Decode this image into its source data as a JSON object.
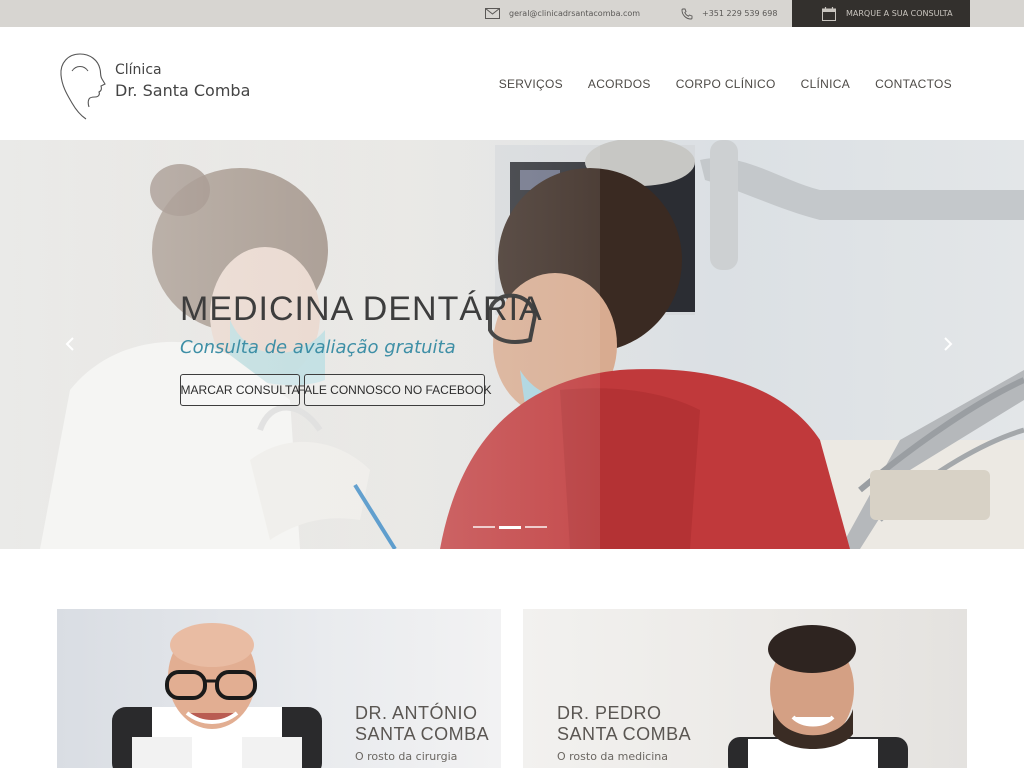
{
  "topbar": {
    "email": "geral@clinicadrsantacomba.com",
    "phone": "+351 229 539 698",
    "cta_label": "MARQUE A SUA CONSULTA"
  },
  "header": {
    "logo_line1": "Clínica",
    "logo_line2": "Dr. Santa Comba",
    "nav": [
      "SERVIÇOS",
      "ACORDOS",
      "CORPO CLÍNICO",
      "CLÍNICA",
      "CONTACTOS"
    ]
  },
  "hero": {
    "title": "MEDICINA DENTÁRIA",
    "subtitle": "Consulta de avaliação gratuita",
    "button_primary": "MARCAR CONSULTA",
    "button_secondary": "FALE CONNOSCO NO FACEBOOK",
    "slide_count": 3,
    "active_slide": 2
  },
  "doctors": [
    {
      "name_line1": "DR. ANTÓNIO",
      "name_line2": "SANTA COMBA",
      "description": "O rosto da cirurgia"
    },
    {
      "name_line1": "DR. PEDRO",
      "name_line2": "SANTA COMBA",
      "description": "O rosto da medicina"
    }
  ],
  "colors": {
    "topbar_bg": "#d7d5d1",
    "cta_bg": "#33302d",
    "accent": "#3e8fa6",
    "scrub_red": "#c0393b"
  },
  "icons": [
    "envelope-icon",
    "phone-icon",
    "calendar-icon",
    "chevron-left-icon",
    "chevron-right-icon"
  ]
}
